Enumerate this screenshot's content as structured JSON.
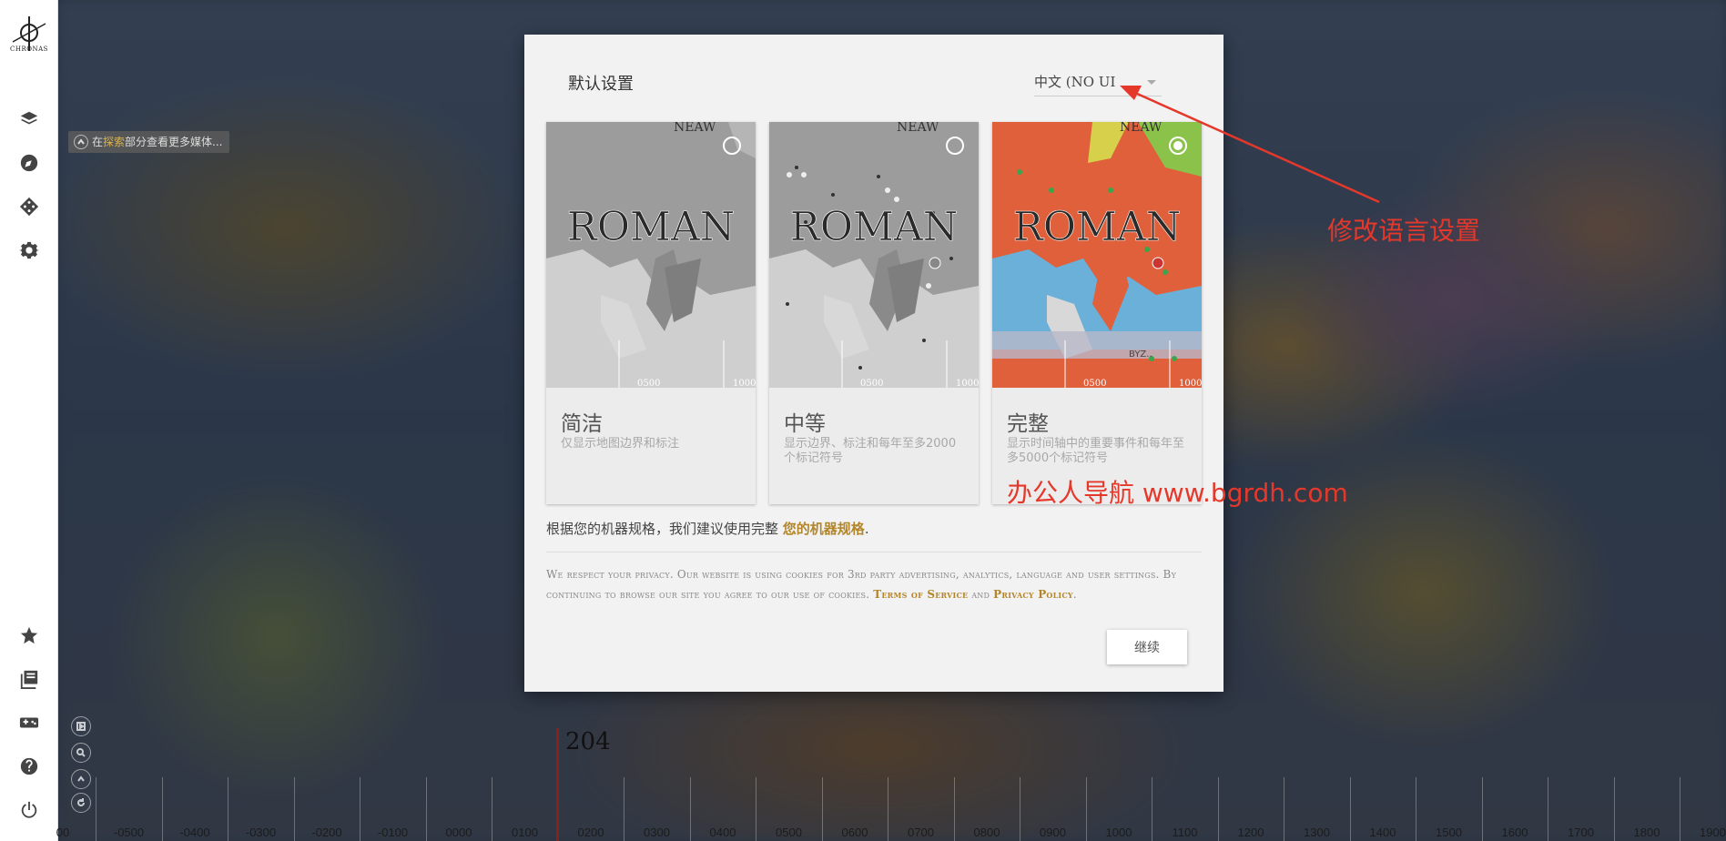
{
  "app": {
    "logo_text": "CHRONAS"
  },
  "sidebar": {
    "top_icons": [
      "layers-icon",
      "compass-icon",
      "dice-icon",
      "gear-icon"
    ],
    "bottom_icons": [
      "star-icon",
      "collection-icon",
      "gamepad-icon",
      "help-icon",
      "power-icon"
    ]
  },
  "hint": {
    "prefix": "在",
    "highlight": "探索",
    "suffix": "部分查看更多媒体..."
  },
  "timeline": {
    "current_year": "204",
    "labels": [
      "00",
      "-0500",
      "-0400",
      "-0300",
      "-0200",
      "-0100",
      "0000",
      "0100",
      "0200",
      "0300",
      "0400",
      "0500",
      "0600",
      "0700",
      "0800",
      "0900",
      "1000",
      "1100",
      "1200",
      "1300",
      "1400",
      "1500",
      "1600",
      "1700",
      "1800",
      "1900"
    ],
    "controls": [
      "play-icon",
      "zoom-icon",
      "up-icon",
      "reset-icon"
    ]
  },
  "modal": {
    "title": "默认设置",
    "language": "中文 (NO UI",
    "cards": [
      {
        "title": "简洁",
        "desc": "仅显示地图边界和标注",
        "selected": false,
        "map_label": "ROMAN",
        "top_label": "NEAW",
        "tick_a": "0500",
        "tick_b": "1000"
      },
      {
        "title": "中等",
        "desc": "显示边界、标注和每年至多2000个标记符号",
        "selected": false,
        "map_label": "ROMAN",
        "top_label": "NEAW",
        "tick_a": "0500",
        "tick_b": "1000"
      },
      {
        "title": "完整",
        "desc": "显示时间轴中的重要事件和每年至多5000个标记符号",
        "selected": true,
        "map_label": "ROMAN",
        "top_label": "NEAW",
        "tick_a": "0500",
        "tick_b": "1000",
        "extra_label": "BYZ.."
      }
    ],
    "recommend_text": "根据您的机器规格，我们建议使用完整",
    "recommend_link": "您的机器规格",
    "recommend_end": ".",
    "privacy_text": "We respect your privacy. Our website is using cookies for 3rd party advertising, analytics, language and user settings. By continuing to browse our site you agree to our use of cookies.",
    "privacy_terms": "Terms of Service",
    "privacy_and": "and",
    "privacy_policy": "Privacy Policy",
    "privacy_end": ".",
    "continue_label": "继续"
  },
  "annotations": {
    "callout": "修改语言设置",
    "watermark": "办公人导航 www.bgrdh.com",
    "color": "#e5382b"
  }
}
